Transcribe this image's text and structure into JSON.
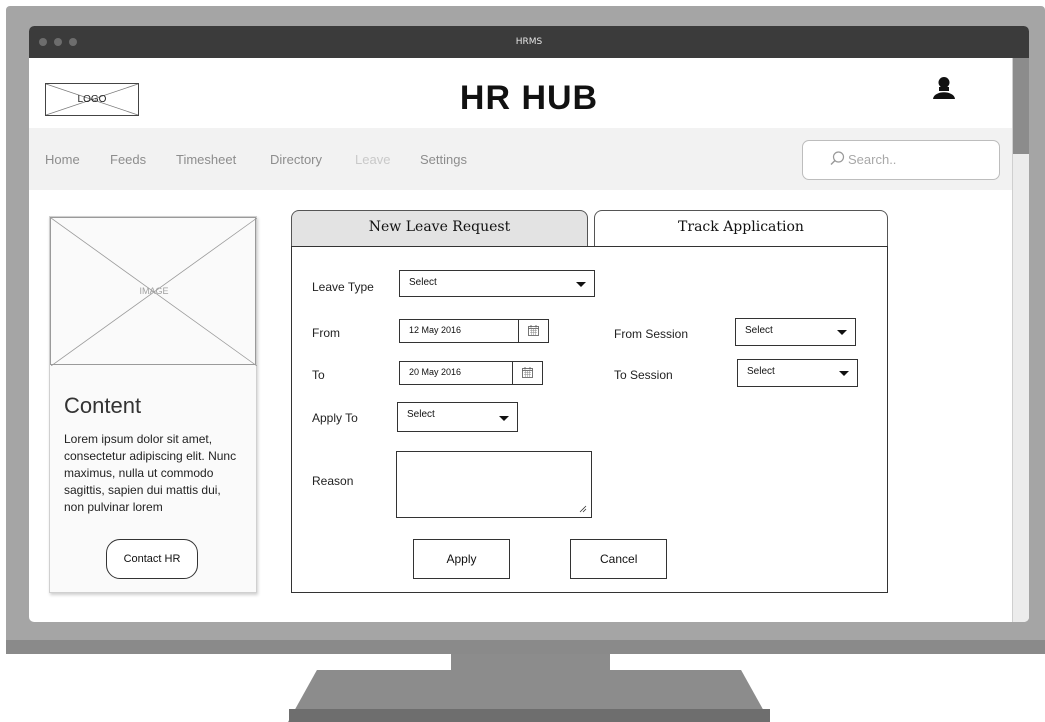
{
  "window": {
    "title": "HRMS"
  },
  "header": {
    "logo_label": "LOGO",
    "brand": "HR HUB",
    "user_icon": "user-icon"
  },
  "nav": {
    "items": [
      "Home",
      "Feeds",
      "Timesheet",
      "Directory",
      "Leave",
      "Settings"
    ],
    "active": "Leave",
    "search_placeholder": "Search.."
  },
  "card": {
    "image_label": "IMAGE",
    "heading": "Content",
    "body": "Lorem ipsum dolor sit amet, consectetur adipiscing elit. Nunc maximus, nulla ut commodo sagittis, sapien dui mattis dui, non pulvinar lorem",
    "button": "Contact HR"
  },
  "tabs": [
    {
      "label": "New Leave Request",
      "selected": true
    },
    {
      "label": "Track Application",
      "selected": false
    }
  ],
  "form": {
    "leave_type": {
      "label": "Leave Type",
      "value": "Select"
    },
    "from": {
      "label": "From",
      "value": "12 May 2016"
    },
    "to": {
      "label": "To",
      "value": "20 May  2016"
    },
    "from_session": {
      "label": "From Session",
      "value": "Select"
    },
    "to_session": {
      "label": "To Session",
      "value": "Select"
    },
    "apply_to": {
      "label": "Apply To",
      "value": "Select"
    },
    "reason": {
      "label": "Reason",
      "value": ""
    },
    "apply_button": "Apply",
    "cancel_button": "Cancel"
  },
  "colors": {
    "titlebar": "#3b3b3b",
    "navbar": "#f2f2f2",
    "bezel": "#a5a5a5",
    "tab_selected": "#e3e3e3"
  }
}
